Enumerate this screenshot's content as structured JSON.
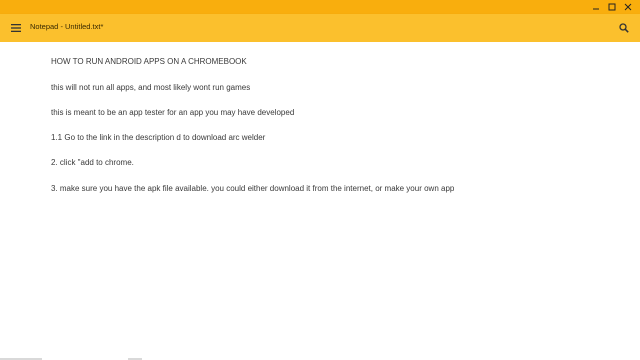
{
  "window": {
    "controls": [
      "minimize-icon",
      "maximize-icon",
      "close-icon"
    ]
  },
  "toolbar": {
    "title": "Notepad - Untitled.txt*",
    "menu_icon": "menu-icon",
    "search_icon": "search-icon"
  },
  "document": {
    "lines": [
      "HOW TO RUN ANDROID APPS ON A CHROMEBOOK",
      "this will not run all apps, and most likely wont run games",
      "this is meant to be an app tester for an app you may have developed",
      "1.1 Go to the link in the description d to download arc welder",
      "2. click \"add to chrome.",
      "3. make sure you have the apk file available. you could either download it from the internet, or make your own app"
    ]
  },
  "colors": {
    "titlebar": "#f9ae0d",
    "toolbar": "#fbc02d",
    "text": "#3a3a3a"
  }
}
